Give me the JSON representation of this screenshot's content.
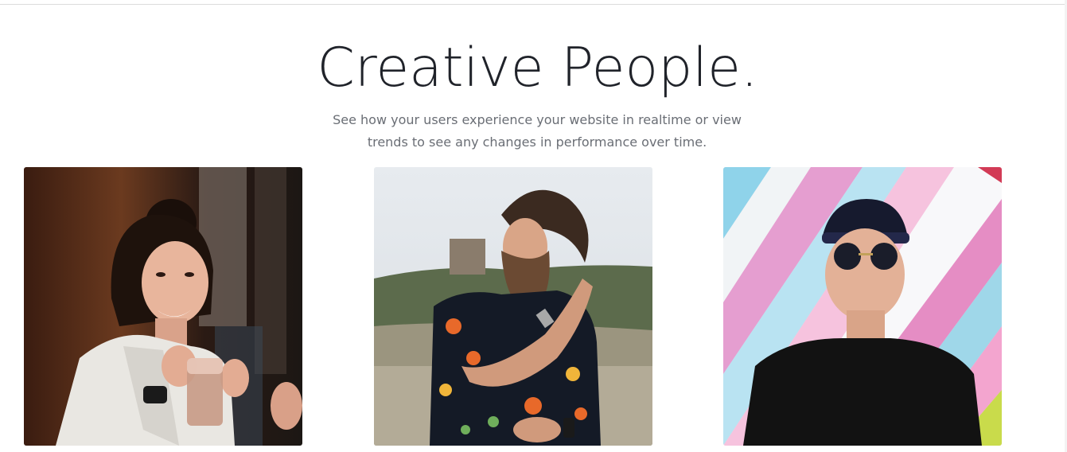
{
  "section": {
    "title": "Creative People.",
    "subtitle_line1": "See how your users experience your website in realtime or view",
    "subtitle_line2": "trends to see any changes in performance over time."
  },
  "people": [
    {
      "photo": "woman-with-coffee-photo"
    },
    {
      "photo": "bearded-man-floral-shirt-photo"
    },
    {
      "photo": "man-with-cap-sunglasses-photo"
    }
  ],
  "colors": {
    "heading": "#20232a",
    "body_text": "#6a6e75",
    "background": "#ffffff"
  }
}
